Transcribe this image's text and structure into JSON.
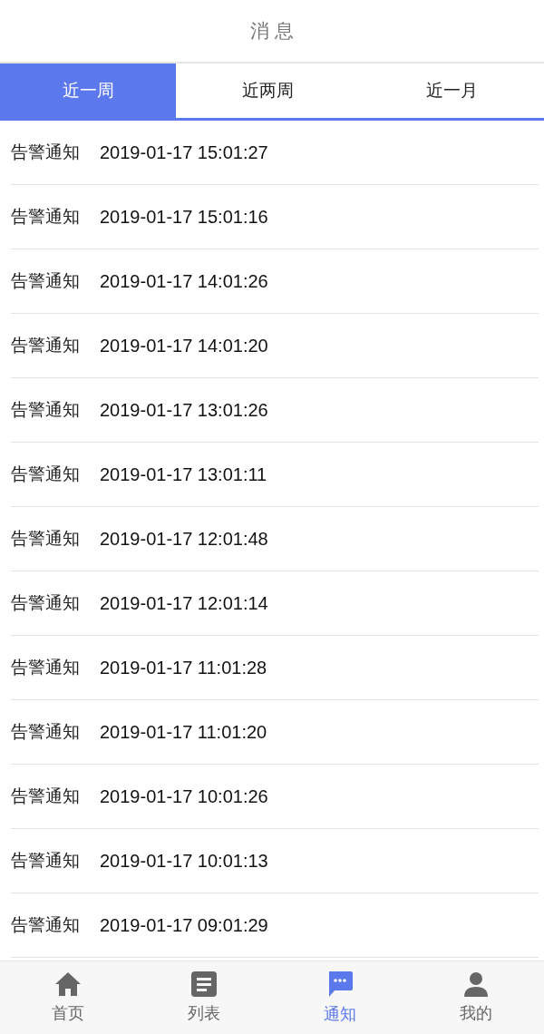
{
  "header": {
    "title": "消 息"
  },
  "tabs": [
    {
      "label": "近一周",
      "selected": true
    },
    {
      "label": "近两周",
      "selected": false
    },
    {
      "label": "近一月",
      "selected": false
    }
  ],
  "messages": [
    {
      "type": "告警通知",
      "time": "2019-01-17 15:01:27"
    },
    {
      "type": "告警通知",
      "time": "2019-01-17 15:01:16"
    },
    {
      "type": "告警通知",
      "time": "2019-01-17 14:01:26"
    },
    {
      "type": "告警通知",
      "time": "2019-01-17 14:01:20"
    },
    {
      "type": "告警通知",
      "time": "2019-01-17 13:01:26"
    },
    {
      "type": "告警通知",
      "time": "2019-01-17 13:01:11"
    },
    {
      "type": "告警通知",
      "time": "2019-01-17 12:01:48"
    },
    {
      "type": "告警通知",
      "time": "2019-01-17 12:01:14"
    },
    {
      "type": "告警通知",
      "time": "2019-01-17 11:01:28"
    },
    {
      "type": "告警通知",
      "time": "2019-01-17 11:01:20"
    },
    {
      "type": "告警通知",
      "time": "2019-01-17 10:01:26"
    },
    {
      "type": "告警通知",
      "time": "2019-01-17 10:01:13"
    },
    {
      "type": "告警通知",
      "time": "2019-01-17 09:01:29"
    }
  ],
  "bottom_nav": [
    {
      "label": "首页",
      "kind": "home",
      "selected": false
    },
    {
      "label": "列表",
      "kind": "list",
      "selected": false
    },
    {
      "label": "通知",
      "kind": "chat",
      "selected": true
    },
    {
      "label": "我的",
      "kind": "person",
      "selected": false
    }
  ]
}
